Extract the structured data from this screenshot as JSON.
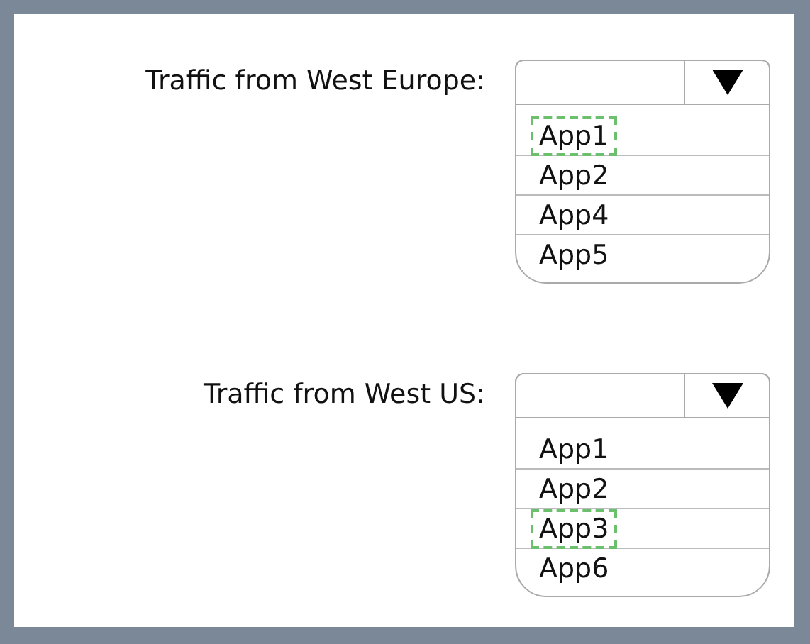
{
  "questions": [
    {
      "label": "Traffic from West Europe:",
      "options": [
        {
          "label": "App1",
          "selected": true
        },
        {
          "label": "App2",
          "selected": false
        },
        {
          "label": "App4",
          "selected": false
        },
        {
          "label": "App5",
          "selected": false
        }
      ]
    },
    {
      "label": "Traffic from West US:",
      "options": [
        {
          "label": "App1",
          "selected": false
        },
        {
          "label": "App2",
          "selected": false
        },
        {
          "label": "App3",
          "selected": true
        },
        {
          "label": "App6",
          "selected": false
        }
      ]
    }
  ]
}
